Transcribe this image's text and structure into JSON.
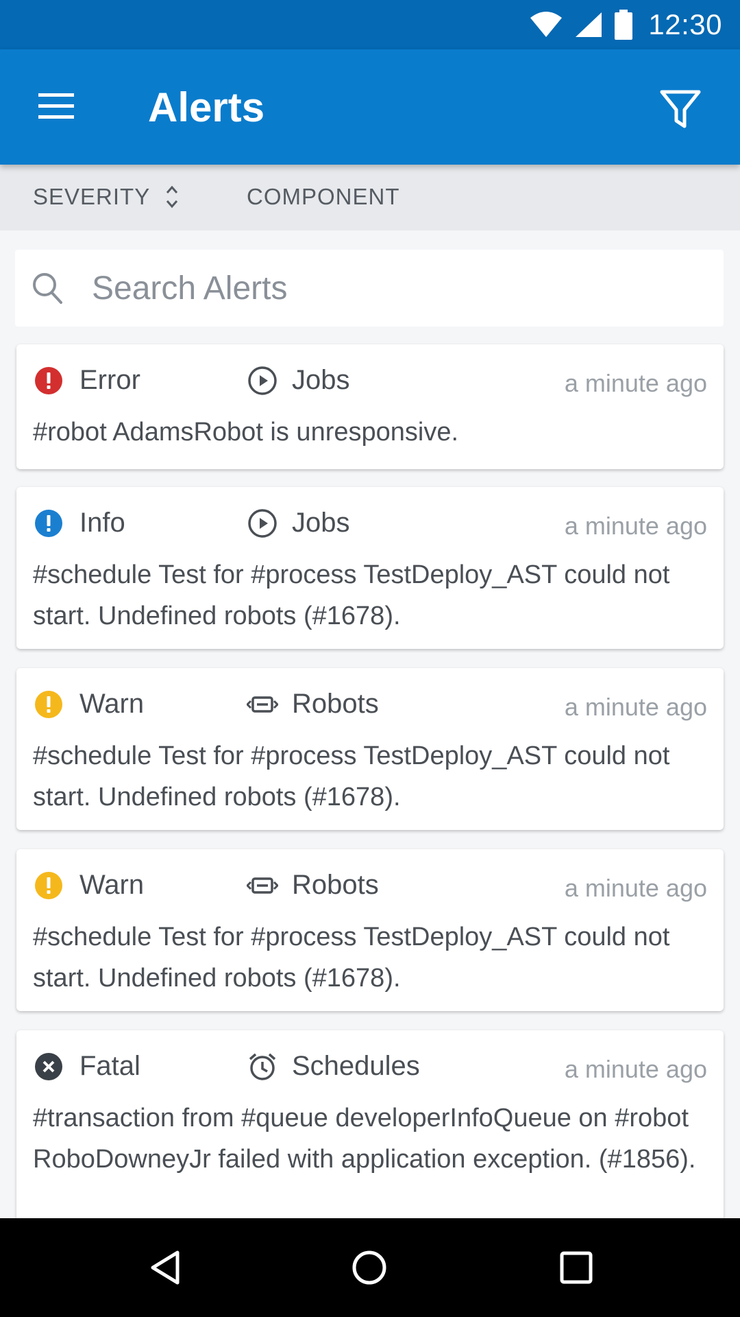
{
  "status_bar": {
    "time": "12:30",
    "icons": [
      "wifi-icon",
      "cell-signal-icon",
      "battery-icon"
    ]
  },
  "app_bar": {
    "title": "Alerts",
    "menu_icon": "hamburger-menu-icon",
    "filter_icon": "filter-icon"
  },
  "sort_bar": {
    "severity_label": "SEVERITY",
    "component_label": "COMPONENT",
    "sort_icon": "sort-up-down-icon"
  },
  "search": {
    "placeholder": "Search Alerts",
    "value": ""
  },
  "colors": {
    "status_bar": "#0569b3",
    "app_bar": "#0a7ccc",
    "error": "#d32f2f",
    "info": "#1b7fd0",
    "warn": "#f5b81c",
    "fatal": "#3a4047"
  },
  "alerts": [
    {
      "severity": "Error",
      "severity_icon": "error-icon",
      "component": "Jobs",
      "component_icon": "play-circle-icon",
      "time": "a minute ago",
      "message": "#robot AdamsRobot is unresponsive."
    },
    {
      "severity": "Info",
      "severity_icon": "info-icon",
      "component": "Jobs",
      "component_icon": "play-circle-icon",
      "time": "a minute ago",
      "message": "#schedule Test for #process TestDeploy_AST could not start. Undefined robots (#1678)."
    },
    {
      "severity": "Warn",
      "severity_icon": "warning-icon",
      "component": "Robots",
      "component_icon": "robot-icon",
      "time": "a minute ago",
      "message": "#schedule Test for #process TestDeploy_AST could not start. Undefined robots (#1678)."
    },
    {
      "severity": "Warn",
      "severity_icon": "warning-icon",
      "component": "Robots",
      "component_icon": "robot-icon",
      "time": "a minute ago",
      "message": "#schedule Test for #process TestDeploy_AST could not start. Undefined robots (#1678)."
    },
    {
      "severity": "Fatal",
      "severity_icon": "fatal-icon",
      "component": "Schedules",
      "component_icon": "alarm-clock-icon",
      "time": "a minute ago",
      "message": "#transaction from #queue developerInfoQueue on #robot RoboDowneyJr failed with application exception. (#1856)."
    }
  ],
  "nav_bar": {
    "icons": [
      "back-icon",
      "home-icon",
      "recent-apps-icon"
    ]
  }
}
